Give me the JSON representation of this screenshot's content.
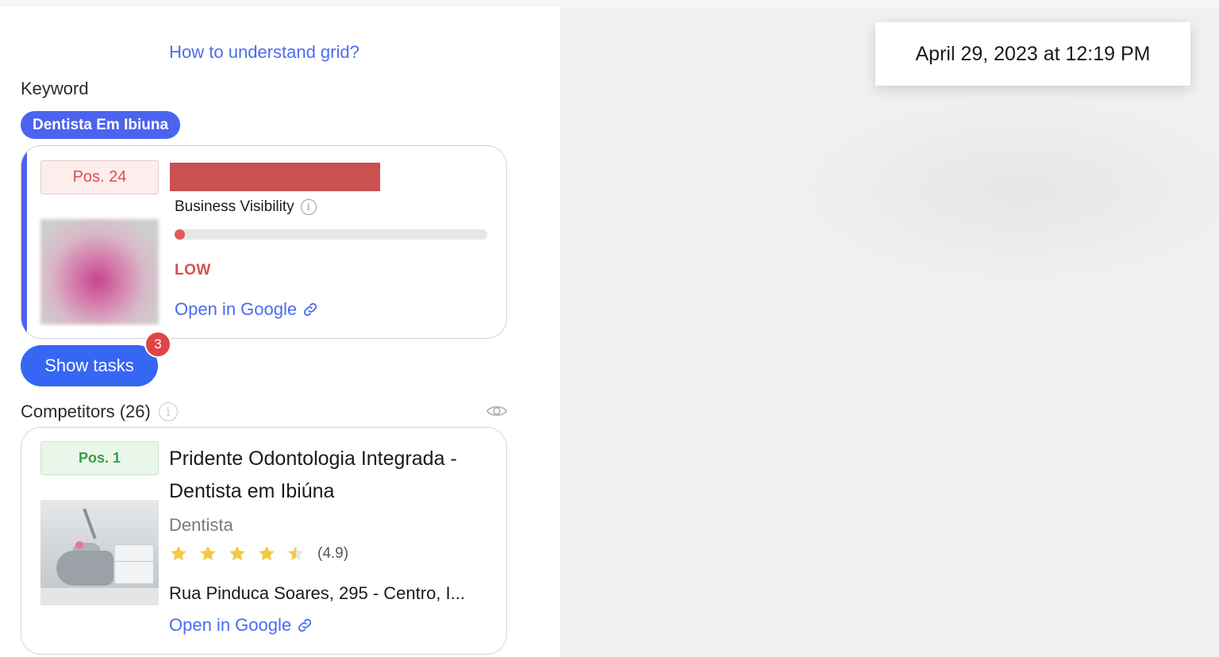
{
  "panel": {
    "grid_link": "How to understand grid?",
    "keyword_label": "Keyword",
    "keyword": "Dentista Em Ibiuna"
  },
  "business": {
    "position": "Pos. 24",
    "visibility_label": "Business Visibility",
    "visibility_fraction": 0.02,
    "visibility_level": "LOW",
    "open_link": "Open in Google"
  },
  "tasks": {
    "button_label": "Show tasks",
    "count": "3"
  },
  "competitors": {
    "title": "Competitors (26)",
    "items": [
      {
        "position": "Pos. 1",
        "name": "Pridente Odontologia Integrada - Dentista em Ibiúna",
        "category": "Dentista",
        "stars": 4.5,
        "rating": "(4.9)",
        "address": "Rua Pinduca Soares, 295 - Centro, I...",
        "open_link": "Open in Google"
      }
    ]
  },
  "map": {
    "timestamp": "April 29, 2023 at 12:19 PM"
  },
  "colors": {
    "accent": "#4b63ee",
    "link": "#4a6cf2",
    "low": "#d65151",
    "star": "#f5c842"
  },
  "icons": [
    "info-icon",
    "link-icon",
    "eye-icon",
    "star-icon"
  ]
}
